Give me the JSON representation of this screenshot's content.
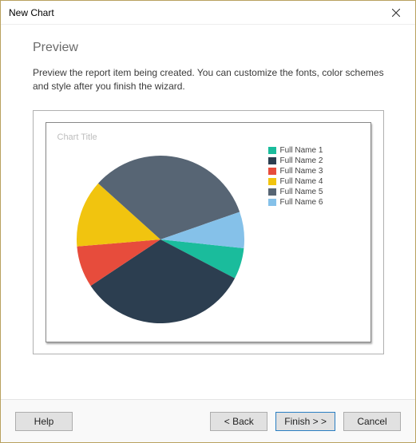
{
  "window": {
    "title": "New Chart"
  },
  "section": {
    "heading": "Preview",
    "description": "Preview the report item being created. You can customize the fonts, color schemes and style after you finish the wizard."
  },
  "chart_data": {
    "type": "pie",
    "title": "Chart Title",
    "series": [
      {
        "name": "Full Name 1",
        "value": 6,
        "color": "#1ABC9C"
      },
      {
        "name": "Full Name 2",
        "value": 33,
        "color": "#2C3E50"
      },
      {
        "name": "Full Name 3",
        "value": 8,
        "color": "#E74C3C"
      },
      {
        "name": "Full Name 4",
        "value": 13,
        "color": "#F1C40F"
      },
      {
        "name": "Full Name 5",
        "value": 33,
        "color": "#576574"
      },
      {
        "name": "Full Name 6",
        "value": 7,
        "color": "#85C1E9"
      }
    ]
  },
  "buttons": {
    "help": "Help",
    "back": "<  Back",
    "finish": "Finish  > >",
    "cancel": "Cancel"
  }
}
